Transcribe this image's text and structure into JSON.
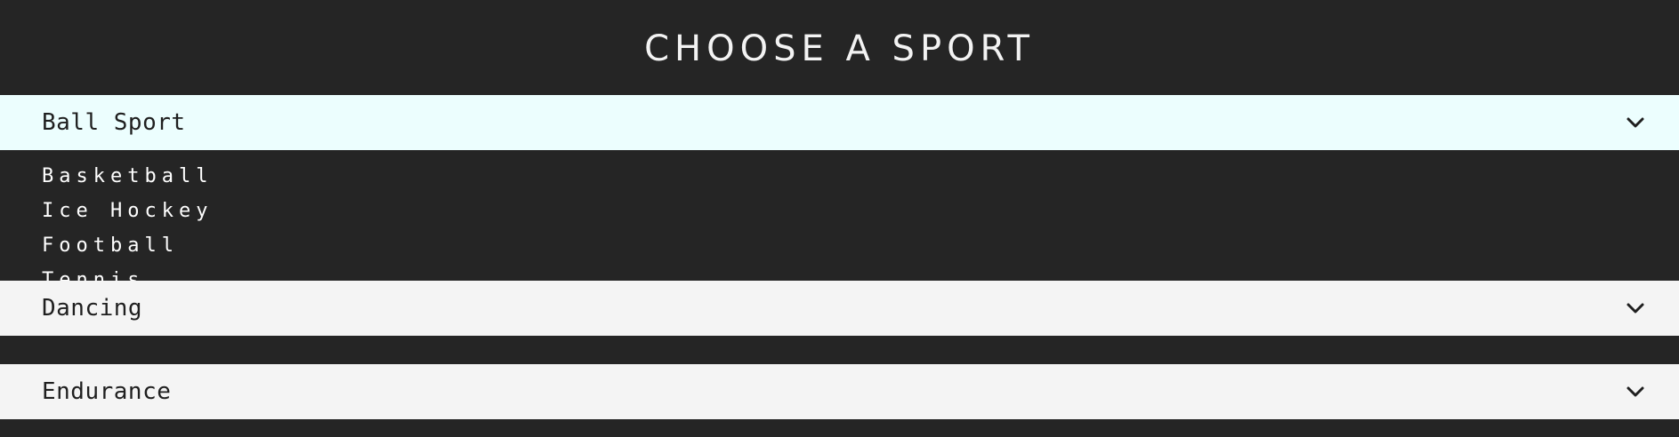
{
  "header": {
    "title": "CHOOSE A SPORT"
  },
  "sections": [
    {
      "label": "Ball Sport",
      "icon": "chevron-down-icon",
      "items": [
        "Basketball",
        "Ice Hockey",
        "Football",
        "Tennis"
      ]
    },
    {
      "label": "Dancing",
      "icon": "chevron-down-icon",
      "items": []
    },
    {
      "label": "Endurance",
      "icon": "chevron-down-icon",
      "items": []
    }
  ],
  "colors": {
    "background": "#252525",
    "open_header": "#ecfefe",
    "closed_header": "#f4f4f4",
    "header_text": "#1f1f1f",
    "title_text": "#f3f3f3"
  }
}
